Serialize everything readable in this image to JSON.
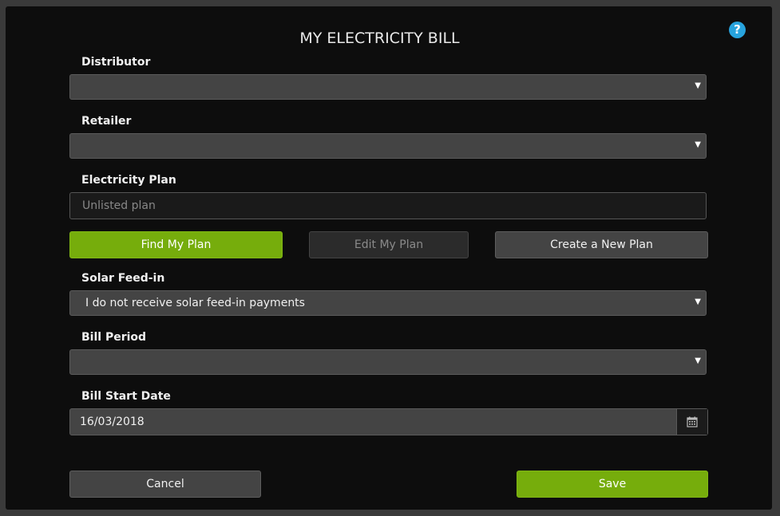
{
  "title": "MY ELECTRICITY BILL",
  "help_icon": "?",
  "distributor": {
    "label": "Distributor",
    "value": ""
  },
  "retailer": {
    "label": "Retailer",
    "value": ""
  },
  "plan": {
    "label": "Electricity Plan",
    "placeholder": "Unlisted plan"
  },
  "buttons": {
    "find": "Find My Plan",
    "edit": "Edit My Plan",
    "create": "Create a New Plan",
    "cancel": "Cancel",
    "save": "Save"
  },
  "solar": {
    "label": "Solar Feed-in",
    "value": "I do not receive solar feed-in payments"
  },
  "bill_period": {
    "label": "Bill Period",
    "value": ""
  },
  "start_date": {
    "label": "Bill Start Date",
    "value": "16/03/2018"
  },
  "colors": {
    "accent_green": "#76ad0c",
    "help_blue": "#27a3dd"
  }
}
